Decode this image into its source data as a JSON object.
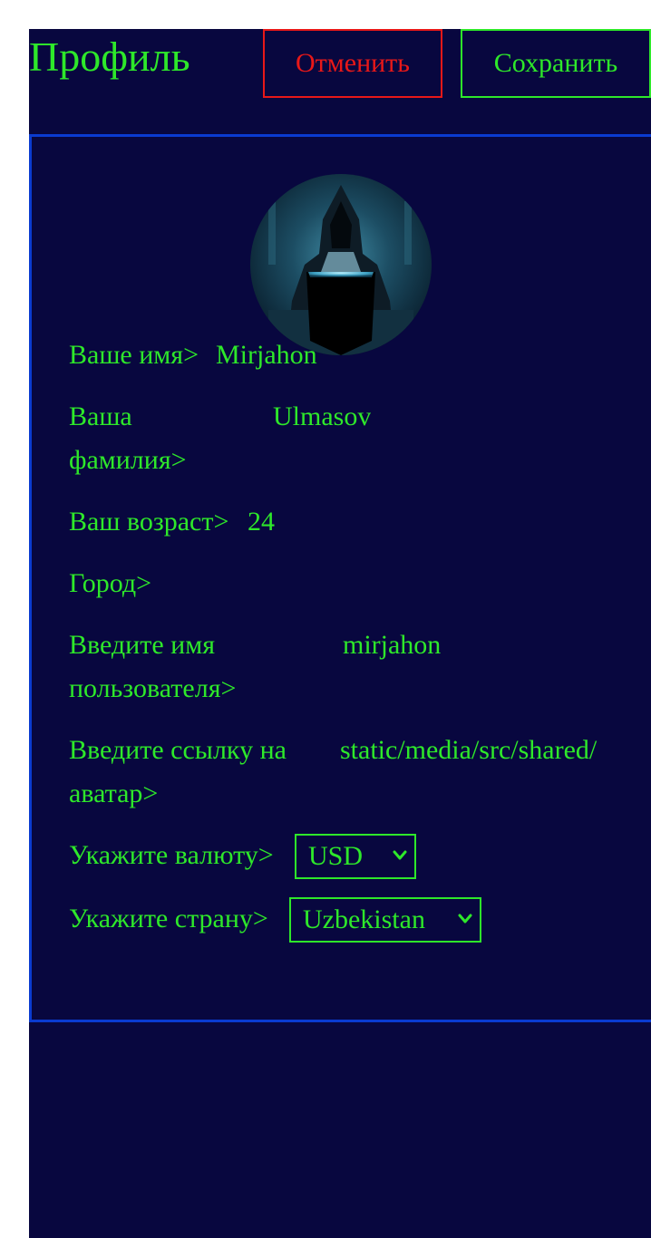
{
  "header": {
    "title": "Профиль",
    "cancel_label": "Отменить",
    "save_label": "Сохранить"
  },
  "profile": {
    "first_name": {
      "label": "Ваше имя>",
      "value": "Mirjahon"
    },
    "last_name": {
      "label_line1": "Ваша",
      "label_line2": "фамилия>",
      "value": "Ulmasov"
    },
    "age": {
      "label": "Ваш возраст>",
      "value": "24"
    },
    "city": {
      "label": "Город>",
      "value": ""
    },
    "username": {
      "label_line1": "Введите имя",
      "label_line2": "пользователя>",
      "value": "mirjahon"
    },
    "avatar_link": {
      "label_line1": "Введите ссылку на",
      "label_line2": "аватар>",
      "value": "static/media/src/shared/"
    },
    "currency": {
      "label": "Укажите валюту>",
      "selected": "USD"
    },
    "country": {
      "label": "Укажите страну>",
      "selected": "Uzbekistan"
    }
  },
  "colors": {
    "background": "#08073f",
    "text": "#2ee82a",
    "cancel": "#e81818",
    "card_border": "#0a3bd0"
  },
  "icons": {
    "select_arrow": "chevron-down-icon"
  }
}
